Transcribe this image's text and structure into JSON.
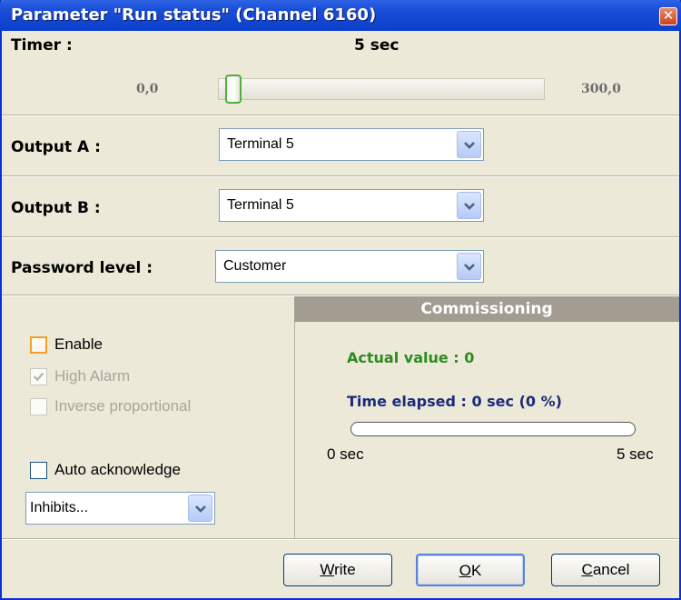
{
  "window": {
    "title": "Parameter \"Run status\" (Channel 6160)",
    "close_glyph": "✕"
  },
  "timer": {
    "label": "Timer :",
    "value_text": "5 sec",
    "min_label": "0,0",
    "max_label": "300,0",
    "value": 5,
    "min": 0,
    "max": 300
  },
  "output_a": {
    "label": "Output A :",
    "value": "Terminal 5"
  },
  "output_b": {
    "label": "Output B :",
    "value": "Terminal 5"
  },
  "password": {
    "label": "Password level :",
    "value": "Customer"
  },
  "options": {
    "enable_label": "Enable",
    "enable_checked": false,
    "high_alarm_label": "High Alarm",
    "high_alarm_checked": true,
    "inverse_label": "Inverse proportional",
    "inverse_checked": false,
    "auto_ack_label": "Auto acknowledge",
    "auto_ack_checked": false,
    "inhibits_value": "Inhibits..."
  },
  "commissioning": {
    "header": "Commissioning",
    "actual_value": "Actual value : 0",
    "time_elapsed": "Time elapsed : 0 sec (0 %)",
    "progress_fraction": 0,
    "start_label": "0 sec",
    "end_label": "5 sec",
    "actual_color": "#2e8b1e",
    "elapsed_color": "#1c2a7a"
  },
  "buttons": {
    "write_accel": "W",
    "write_rest": "rite",
    "ok_accel": "O",
    "ok_rest": "K",
    "cancel_accel": "C",
    "cancel_rest": "ancel"
  },
  "icons": {
    "chevron": "chevron-down-icon",
    "check": "checkmark-icon",
    "close": "close-icon"
  }
}
